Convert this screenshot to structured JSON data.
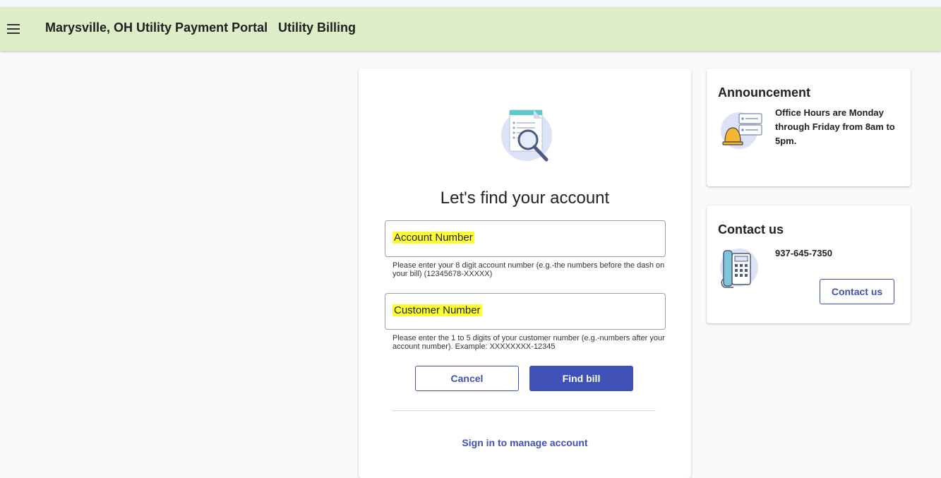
{
  "header": {
    "title": "Marysville, OH Utility Payment Portal",
    "subtitle": "Utility Billing"
  },
  "find_account": {
    "heading": "Let's find your account",
    "account_field": {
      "label": "Account Number",
      "hint": "Please enter your 8 digit account number (e.g.-the numbers before the dash on your bill) (12345678-XXXXX)"
    },
    "customer_field": {
      "label": "Customer Number",
      "hint": "Please enter the 1 to 5 digits of your customer number (e.g.-numbers after your account number). Example: XXXXXXXX-12345"
    },
    "cancel_label": "Cancel",
    "find_label": "Find bill",
    "sign_in_label": "Sign in to manage account"
  },
  "announcement": {
    "title": "Announcement",
    "text": "Office Hours are Monday through Friday from 8am to 5pm."
  },
  "contact": {
    "title": "Contact us",
    "phone": "937-645-7350",
    "button_label": "Contact us"
  },
  "colors": {
    "appbar": "#dcedc8",
    "primary": "#3f51b5",
    "highlight": "#ffff33"
  },
  "icons": [
    "menu-icon",
    "document-search-icon",
    "bell-announcement-icon",
    "telephone-icon"
  ]
}
